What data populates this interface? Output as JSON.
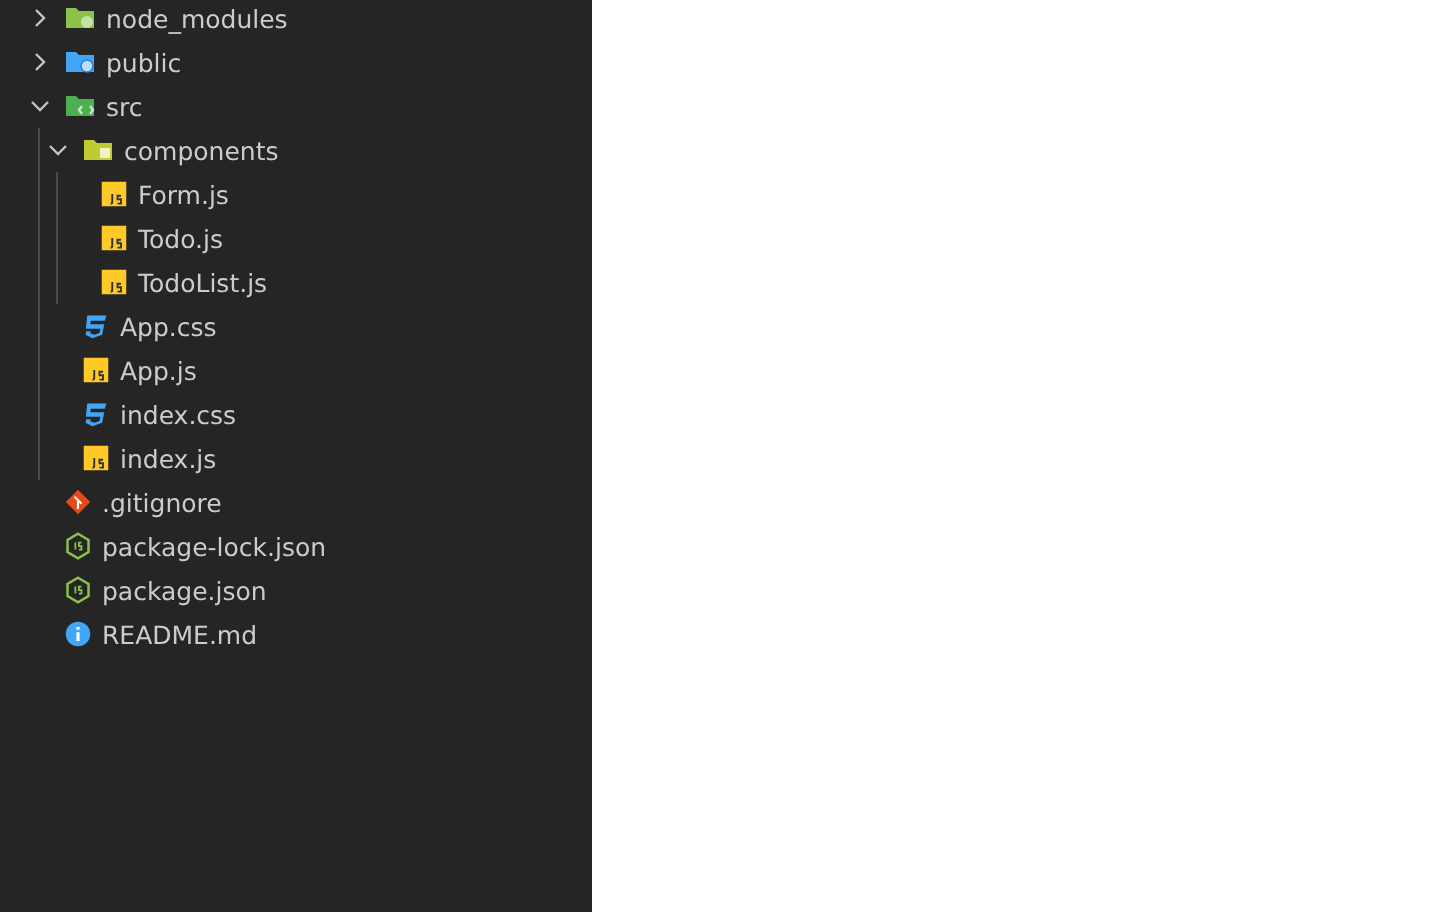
{
  "explorer": {
    "tree": [
      {
        "kind": "folder-node",
        "label": "node_modules",
        "expanded": false
      },
      {
        "kind": "folder-public",
        "label": "public",
        "expanded": false
      },
      {
        "kind": "folder-src",
        "label": "src",
        "expanded": true,
        "children": [
          {
            "kind": "folder-components",
            "label": "components",
            "expanded": true,
            "children": [
              {
                "kind": "js",
                "label": "Form.js"
              },
              {
                "kind": "js",
                "label": "Todo.js"
              },
              {
                "kind": "js",
                "label": "TodoList.js"
              }
            ]
          },
          {
            "kind": "css",
            "label": "App.css"
          },
          {
            "kind": "js",
            "label": "App.js"
          },
          {
            "kind": "css",
            "label": "index.css"
          },
          {
            "kind": "js",
            "label": "index.js"
          }
        ]
      },
      {
        "kind": "git",
        "label": ".gitignore"
      },
      {
        "kind": "npm",
        "label": "package-lock.json"
      },
      {
        "kind": "npm",
        "label": "package.json"
      },
      {
        "kind": "info",
        "label": "README.md"
      }
    ]
  }
}
